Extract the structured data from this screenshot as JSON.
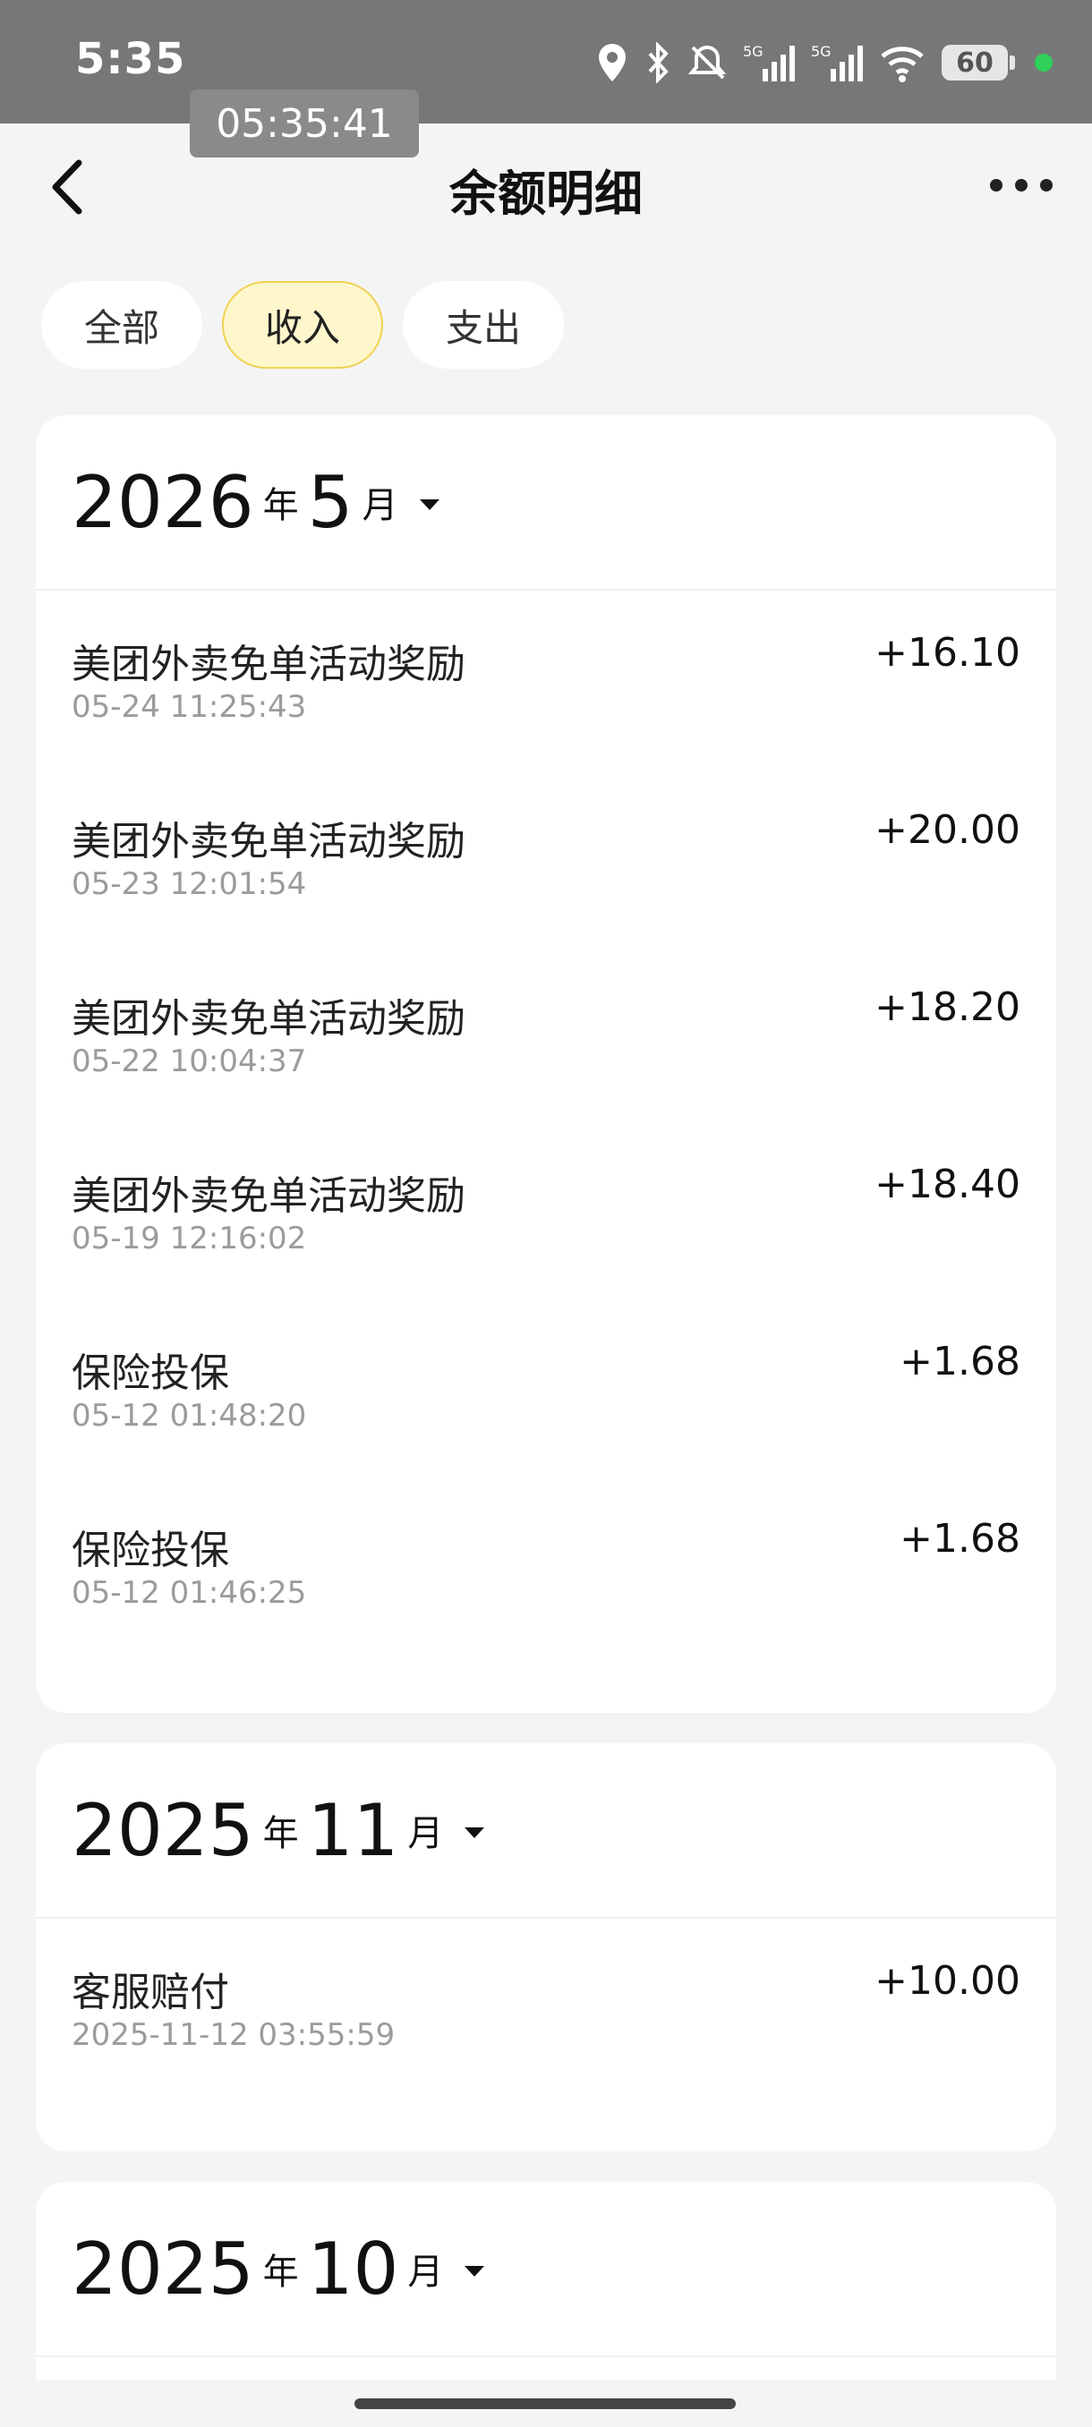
{
  "status_bar": {
    "time": "5:35",
    "battery": "60",
    "signal1": "5G",
    "signal2": "5G"
  },
  "overlay_time": "05:35:41",
  "header": {
    "title": "余额明细"
  },
  "tabs": [
    {
      "label": "全部",
      "active": false
    },
    {
      "label": "收入",
      "active": true
    },
    {
      "label": "支出",
      "active": false
    }
  ],
  "groups": [
    {
      "year": "2026",
      "year_unit": "年",
      "month": "5",
      "month_unit": "月",
      "items": [
        {
          "name": "美团外卖免单活动奖励",
          "time": "05-24 11:25:43",
          "amount": "+16.10"
        },
        {
          "name": "美团外卖免单活动奖励",
          "time": "05-23 12:01:54",
          "amount": "+20.00"
        },
        {
          "name": "美团外卖免单活动奖励",
          "time": "05-22 10:04:37",
          "amount": "+18.20"
        },
        {
          "name": "美团外卖免单活动奖励",
          "time": "05-19 12:16:02",
          "amount": "+18.40"
        },
        {
          "name": "保险投保",
          "time": "05-12 01:48:20",
          "amount": "+1.68"
        },
        {
          "name": "保险投保",
          "time": "05-12 01:46:25",
          "amount": "+1.68"
        }
      ]
    },
    {
      "year": "2025",
      "year_unit": "年",
      "month": "11",
      "month_unit": "月",
      "items": [
        {
          "name": "客服赔付",
          "time": "2025-11-12 03:55:59",
          "amount": "+10.00"
        }
      ]
    },
    {
      "year": "2025",
      "year_unit": "年",
      "month": "10",
      "month_unit": "月",
      "items": []
    }
  ],
  "colors": {
    "status_bar": "#777777",
    "active_tab_bg": "#fff7cc",
    "active_tab_border": "#f0d250"
  }
}
